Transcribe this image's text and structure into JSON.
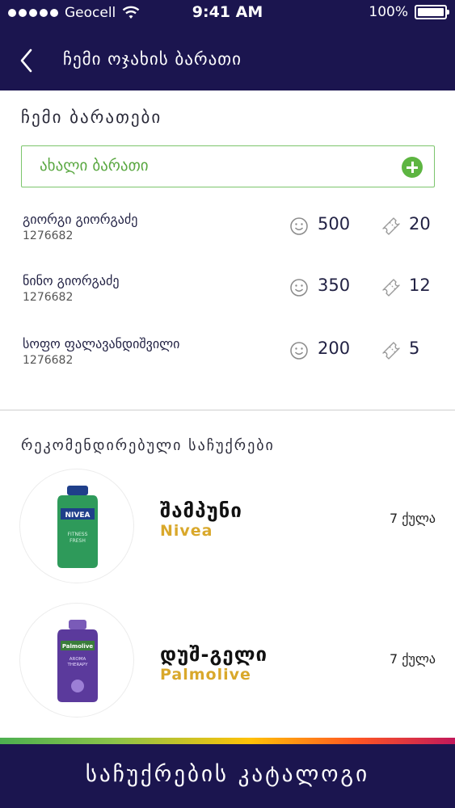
{
  "status_bar": {
    "carrier": "Geocell",
    "time": "9:41 AM",
    "battery": "100%"
  },
  "header": {
    "title": "ჩემი ოჯახის ბარათი"
  },
  "cards_section": {
    "title": "ჩემი ბარათები",
    "new_card_label": "ახალი ბარათი",
    "cards": [
      {
        "name": "გიორგი გიორგაძე",
        "number": "1276682",
        "points": "500",
        "tickets": "20"
      },
      {
        "name": "ნინო გიორგაძე",
        "number": "1276682",
        "points": "350",
        "tickets": "12"
      },
      {
        "name": "სოფო ფალავანდიშვილი",
        "number": "1276682",
        "points": "200",
        "tickets": "5"
      }
    ]
  },
  "recommended_section": {
    "title": "რეკომენდირებული საჩუქრები",
    "products": [
      {
        "name": "შამპუნი",
        "brand": "Nivea",
        "price": "7 ქულა",
        "bottle_color": "#2e9a5a",
        "label_text": "NIVEA"
      },
      {
        "name": "დუშ-გელი",
        "brand": "Palmolive",
        "price": "7 ქულა",
        "bottle_color": "#5b3a9c",
        "label_text": "Palmolive"
      }
    ]
  },
  "footer": {
    "catalog_label": "საჩუქრების კატალოგი"
  },
  "colors": {
    "header_bg": "#1b154f",
    "accent_green": "#5db541",
    "brand_gold": "#d9a82b"
  }
}
